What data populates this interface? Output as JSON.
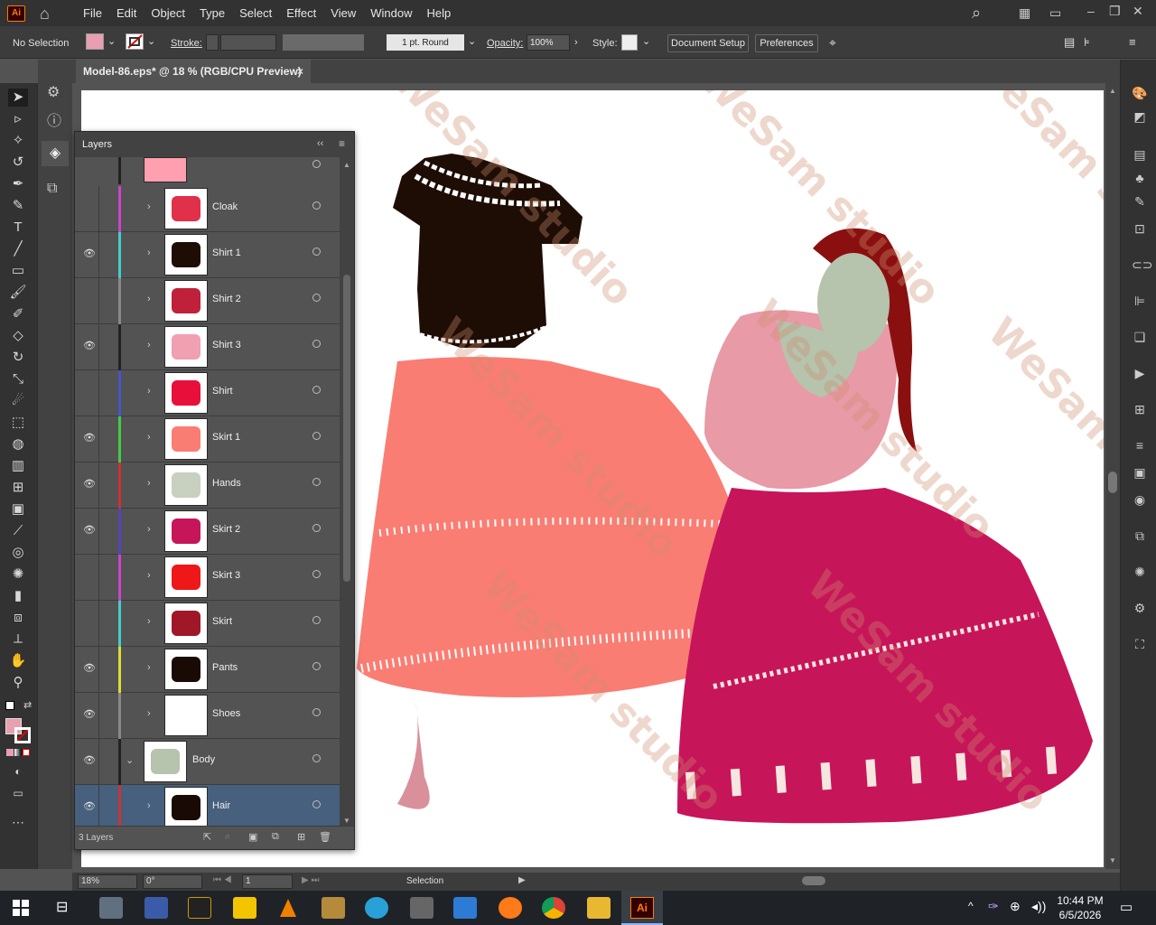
{
  "menubar": {
    "items": [
      "File",
      "Edit",
      "Object",
      "Type",
      "Select",
      "Effect",
      "View",
      "Window",
      "Help"
    ]
  },
  "control": {
    "selection": "No Selection",
    "stroke_label": "Stroke:",
    "brush": "1 pt. Round",
    "opacity_label": "Opacity:",
    "opacity_value": "100%",
    "style_label": "Style:",
    "document_setup": "Document Setup",
    "preferences": "Preferences",
    "fill_color": "#e8a0b0"
  },
  "document": {
    "tab_title": "Model-86.eps* @ 18 % (RGB/CPU Preview)",
    "close": "×"
  },
  "layers_panel": {
    "title": "Layers",
    "footer": "3 Layers",
    "layers": [
      {
        "name": "Cloak",
        "visible": false,
        "color": "#cc44cc"
      },
      {
        "name": "Shirt 1",
        "visible": true,
        "color": "#44cccc"
      },
      {
        "name": "Shirt 2",
        "visible": false,
        "color": "#888888"
      },
      {
        "name": "Shirt 3",
        "visible": true,
        "color": "#222222"
      },
      {
        "name": "Shirt",
        "visible": false,
        "color": "#4455cc"
      },
      {
        "name": "Skirt 1",
        "visible": true,
        "color": "#44cc44"
      },
      {
        "name": "Hands",
        "visible": true,
        "color": "#cc3333"
      },
      {
        "name": "Skirt 2",
        "visible": true,
        "color": "#5544bb"
      },
      {
        "name": "Skirt 3",
        "visible": false,
        "color": "#cc44cc"
      },
      {
        "name": "Skirt",
        "visible": false,
        "color": "#44cccc"
      },
      {
        "name": "Pants",
        "visible": true,
        "color": "#dddd33"
      },
      {
        "name": "Shoes",
        "visible": true,
        "color": "#888888"
      },
      {
        "name": "Body",
        "visible": true,
        "color": "#222222"
      },
      {
        "name": "Hair",
        "visible": true,
        "color": "#cc3333"
      }
    ]
  },
  "watermark": "WeSam studio",
  "status": {
    "zoom": "18%",
    "rotation": "0°",
    "artboard": "1",
    "tool": "Selection"
  },
  "taskbar": {
    "time": "10:44 PM",
    "date": "6/5/2026"
  }
}
